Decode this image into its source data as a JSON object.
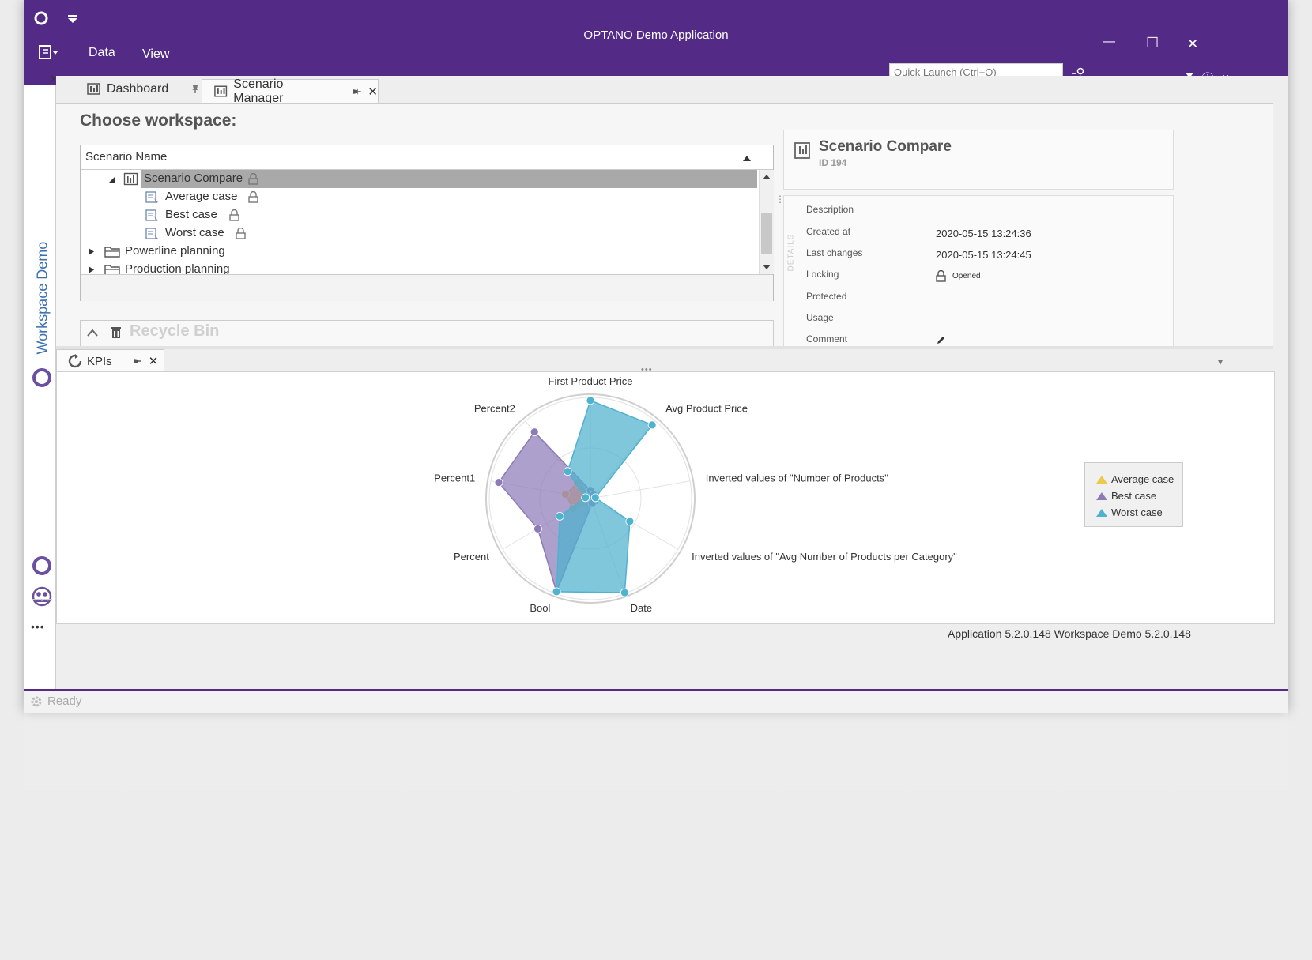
{
  "window": {
    "title": "OPTANO Demo Application",
    "menu": [
      {
        "label": "Data"
      },
      {
        "label": "View"
      }
    ],
    "quick_launch_placeholder": "Quick Launch (Ctrl+Q)",
    "minimize_glyph": "—",
    "maximize_glyph": "☐",
    "close_glyph": "✕",
    "help_glyph": "ⓘ",
    "chevron_glyph": "⌄"
  },
  "sidebar": {
    "expand_glyph": "›",
    "workspace_label": "Workspace Demo",
    "more_glyph": "•••"
  },
  "tabs": {
    "dashboard": "Dashboard",
    "scenario_manager": "Scenario Manager",
    "kpis": "KPIs",
    "close_glyph": "✕"
  },
  "scenario_manager": {
    "heading": "Choose workspace:",
    "column_header": "Scenario Name",
    "tree": [
      {
        "label": "Scenario Compare",
        "level": 0,
        "expanded": true,
        "selected": true,
        "type": "compare",
        "locked": true
      },
      {
        "label": "Average case",
        "level": 1,
        "type": "scenario",
        "locked": true
      },
      {
        "label": "Best case",
        "level": 1,
        "type": "scenario",
        "locked": true
      },
      {
        "label": "Worst case",
        "level": 1,
        "type": "scenario",
        "locked": true
      },
      {
        "label": "Powerline planning",
        "level": -1,
        "type": "folder",
        "expanded": false
      },
      {
        "label": "Production planning",
        "level": -1,
        "type": "folder",
        "expanded": false
      }
    ],
    "recycle_bin": "Recycle Bin"
  },
  "details": {
    "title": "Scenario Compare",
    "id_label": "ID 194",
    "vertical_label": "DETAILS",
    "rows": [
      {
        "label": "Description",
        "value": ""
      },
      {
        "label": "Created at",
        "value": "2020-05-15 13:24:36"
      },
      {
        "label": "Last changes",
        "value": "2020-05-15 13:24:45"
      },
      {
        "label": "Locking",
        "value": "Opened"
      },
      {
        "label": "Protected",
        "value": "-"
      },
      {
        "label": "Usage",
        "value": ""
      },
      {
        "label": "Comment",
        "value": ""
      }
    ]
  },
  "chart_data": {
    "type": "radar",
    "axes": [
      "First Product Price",
      "Avg Product Price",
      "Inverted values of \"Number of Products\"",
      "Inverted values of \"Avg Number of Products per Category\"",
      "Date",
      "Bool",
      "Percent",
      "Percent1",
      "Percent2"
    ],
    "rmax": 1.0,
    "grid": true,
    "legend": "right",
    "series": [
      {
        "name": "Average case",
        "color": "#f0c94a",
        "values": [
          0.05,
          0.05,
          0.05,
          0.05,
          0.05,
          0.05,
          0.2,
          0.25,
          0.2
        ]
      },
      {
        "name": "Best case",
        "color": "#8d7bb8",
        "values": [
          0.08,
          0.05,
          0.05,
          0.05,
          0.05,
          0.98,
          0.6,
          0.92,
          0.86
        ]
      },
      {
        "name": "Worst case",
        "color": "#4fb2cf",
        "values": [
          0.97,
          0.95,
          0.05,
          0.45,
          0.99,
          0.98,
          0.35,
          0.05,
          0.35
        ]
      }
    ]
  },
  "status": {
    "ready": "Ready",
    "versions": "Application 5.2.0.148  Workspace Demo 5.2.0.148"
  }
}
